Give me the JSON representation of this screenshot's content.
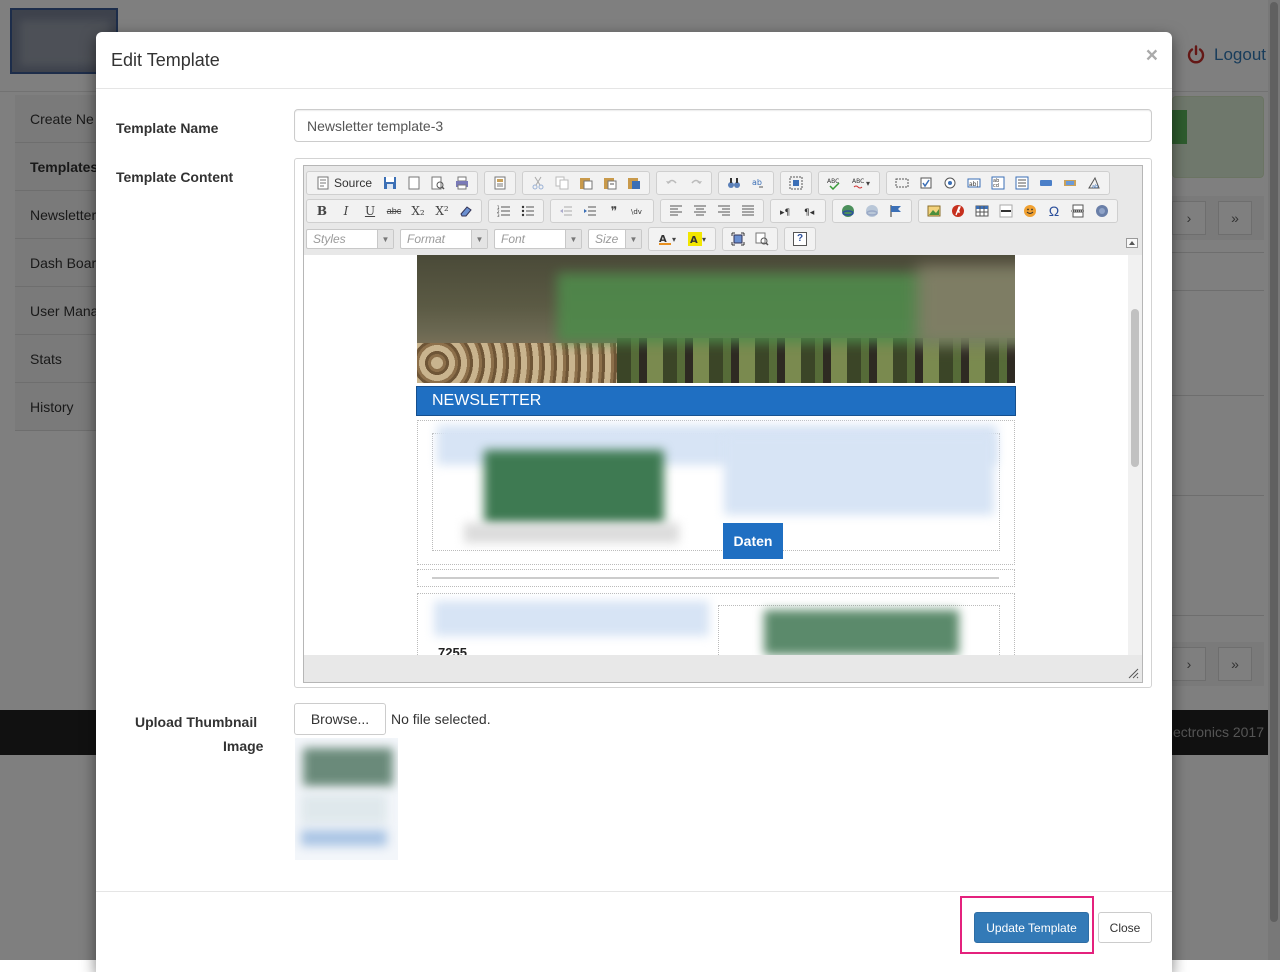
{
  "background": {
    "logout_label": "Logout",
    "sidebar_items": [
      {
        "label": "Create Ne",
        "bold": false
      },
      {
        "label": "Templates",
        "bold": true
      },
      {
        "label": "Newsletter",
        "bold": false
      },
      {
        "label": "Dash Boar",
        "bold": false
      },
      {
        "label": "User Mana",
        "bold": false
      },
      {
        "label": "Stats",
        "bold": false
      },
      {
        "label": "History",
        "bold": false
      }
    ],
    "footer_text": "ectronics 2017",
    "pager_next": "›",
    "pager_last": "»"
  },
  "modal": {
    "title": "Edit Template",
    "close_glyph": "×",
    "template_name_label": "Template Name",
    "template_name_value": "Newsletter template-3",
    "template_content_label": "Template Content",
    "upload_label_line1": "Upload Thumbnail",
    "upload_label_line2": "Image",
    "browse_label": "Browse...",
    "no_file_text": "No file selected.",
    "update_button": "Update Template",
    "close_button": "Close"
  },
  "editor": {
    "source_label": "Source",
    "combos": {
      "styles": "Styles",
      "format": "Format",
      "font": "Font",
      "size": "Size"
    },
    "toolbar_glyphs": {
      "bold": "B",
      "italic": "I",
      "underline": "U",
      "strike": "abc",
      "subscript": "X₂",
      "superscript": "X²",
      "blockquote": "❞",
      "help": "?",
      "omega": "Ω"
    }
  },
  "newsletter_preview": {
    "banner_title": "NEWSLETTER",
    "daten_button": "Daten",
    "visible_number": "7255"
  },
  "colors": {
    "primary": "#337ab7",
    "newsletter_blue": "#1f6fc2",
    "focus_ring": "#e4217d",
    "logout_red": "#c9302c"
  }
}
